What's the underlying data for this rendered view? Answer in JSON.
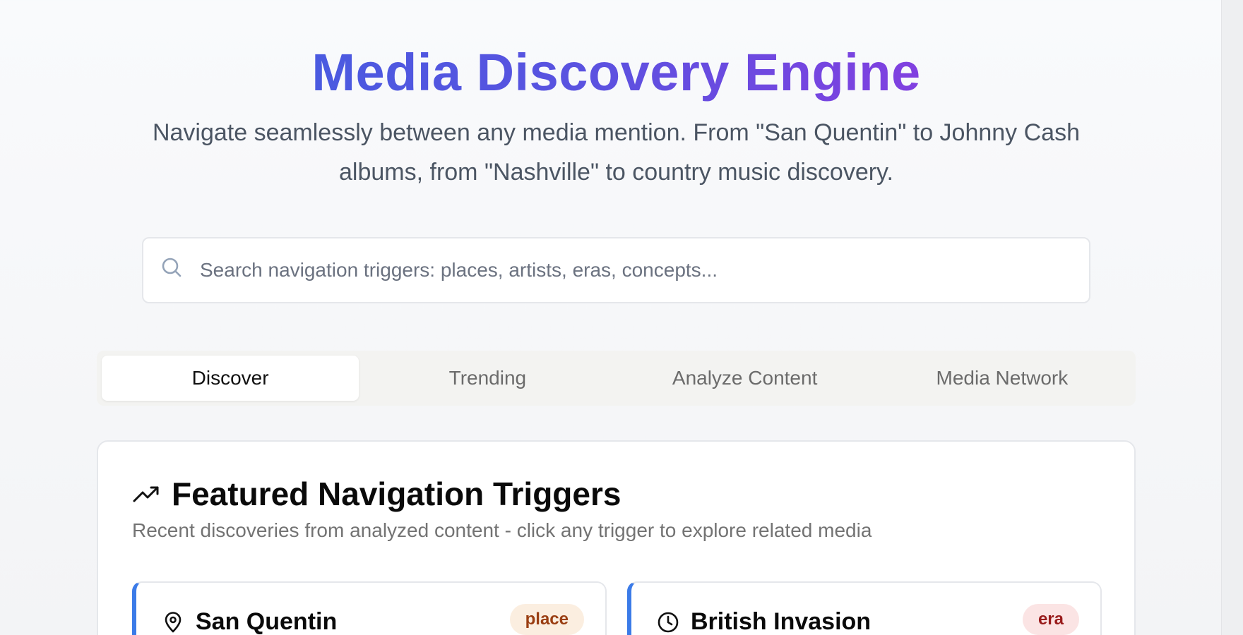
{
  "hero": {
    "title": "Media Discovery Engine",
    "subtitle": "Navigate seamlessly between any media mention. From \"San Quentin\" to Johnny Cash albums, from \"Nashville\" to country music discovery."
  },
  "search": {
    "icon": "search-icon",
    "placeholder": "Search navigation triggers: places, artists, eras, concepts...",
    "value": ""
  },
  "tabs": [
    {
      "label": "Discover",
      "active": true
    },
    {
      "label": "Trending",
      "active": false
    },
    {
      "label": "Analyze Content",
      "active": false
    },
    {
      "label": "Media Network",
      "active": false
    }
  ],
  "featured": {
    "icon": "trending-up-icon",
    "title": "Featured Navigation Triggers",
    "description": "Recent discoveries from analyzed content - click any trigger to explore related media",
    "triggers": [
      {
        "name": "San Quentin",
        "type": "place",
        "icon": "map-pin-icon",
        "accent": "#3b7be8"
      },
      {
        "name": "British Invasion",
        "type": "era",
        "icon": "clock-icon",
        "accent": "#3b7be8"
      }
    ]
  },
  "colors": {
    "title_gradient_start": "#4a5ae0",
    "title_gradient_end": "#8140e0",
    "place_badge_bg": "#fbeee0",
    "place_badge_text": "#9a3e12",
    "era_badge_bg": "#fbe4e4",
    "era_badge_text": "#991b1b"
  }
}
